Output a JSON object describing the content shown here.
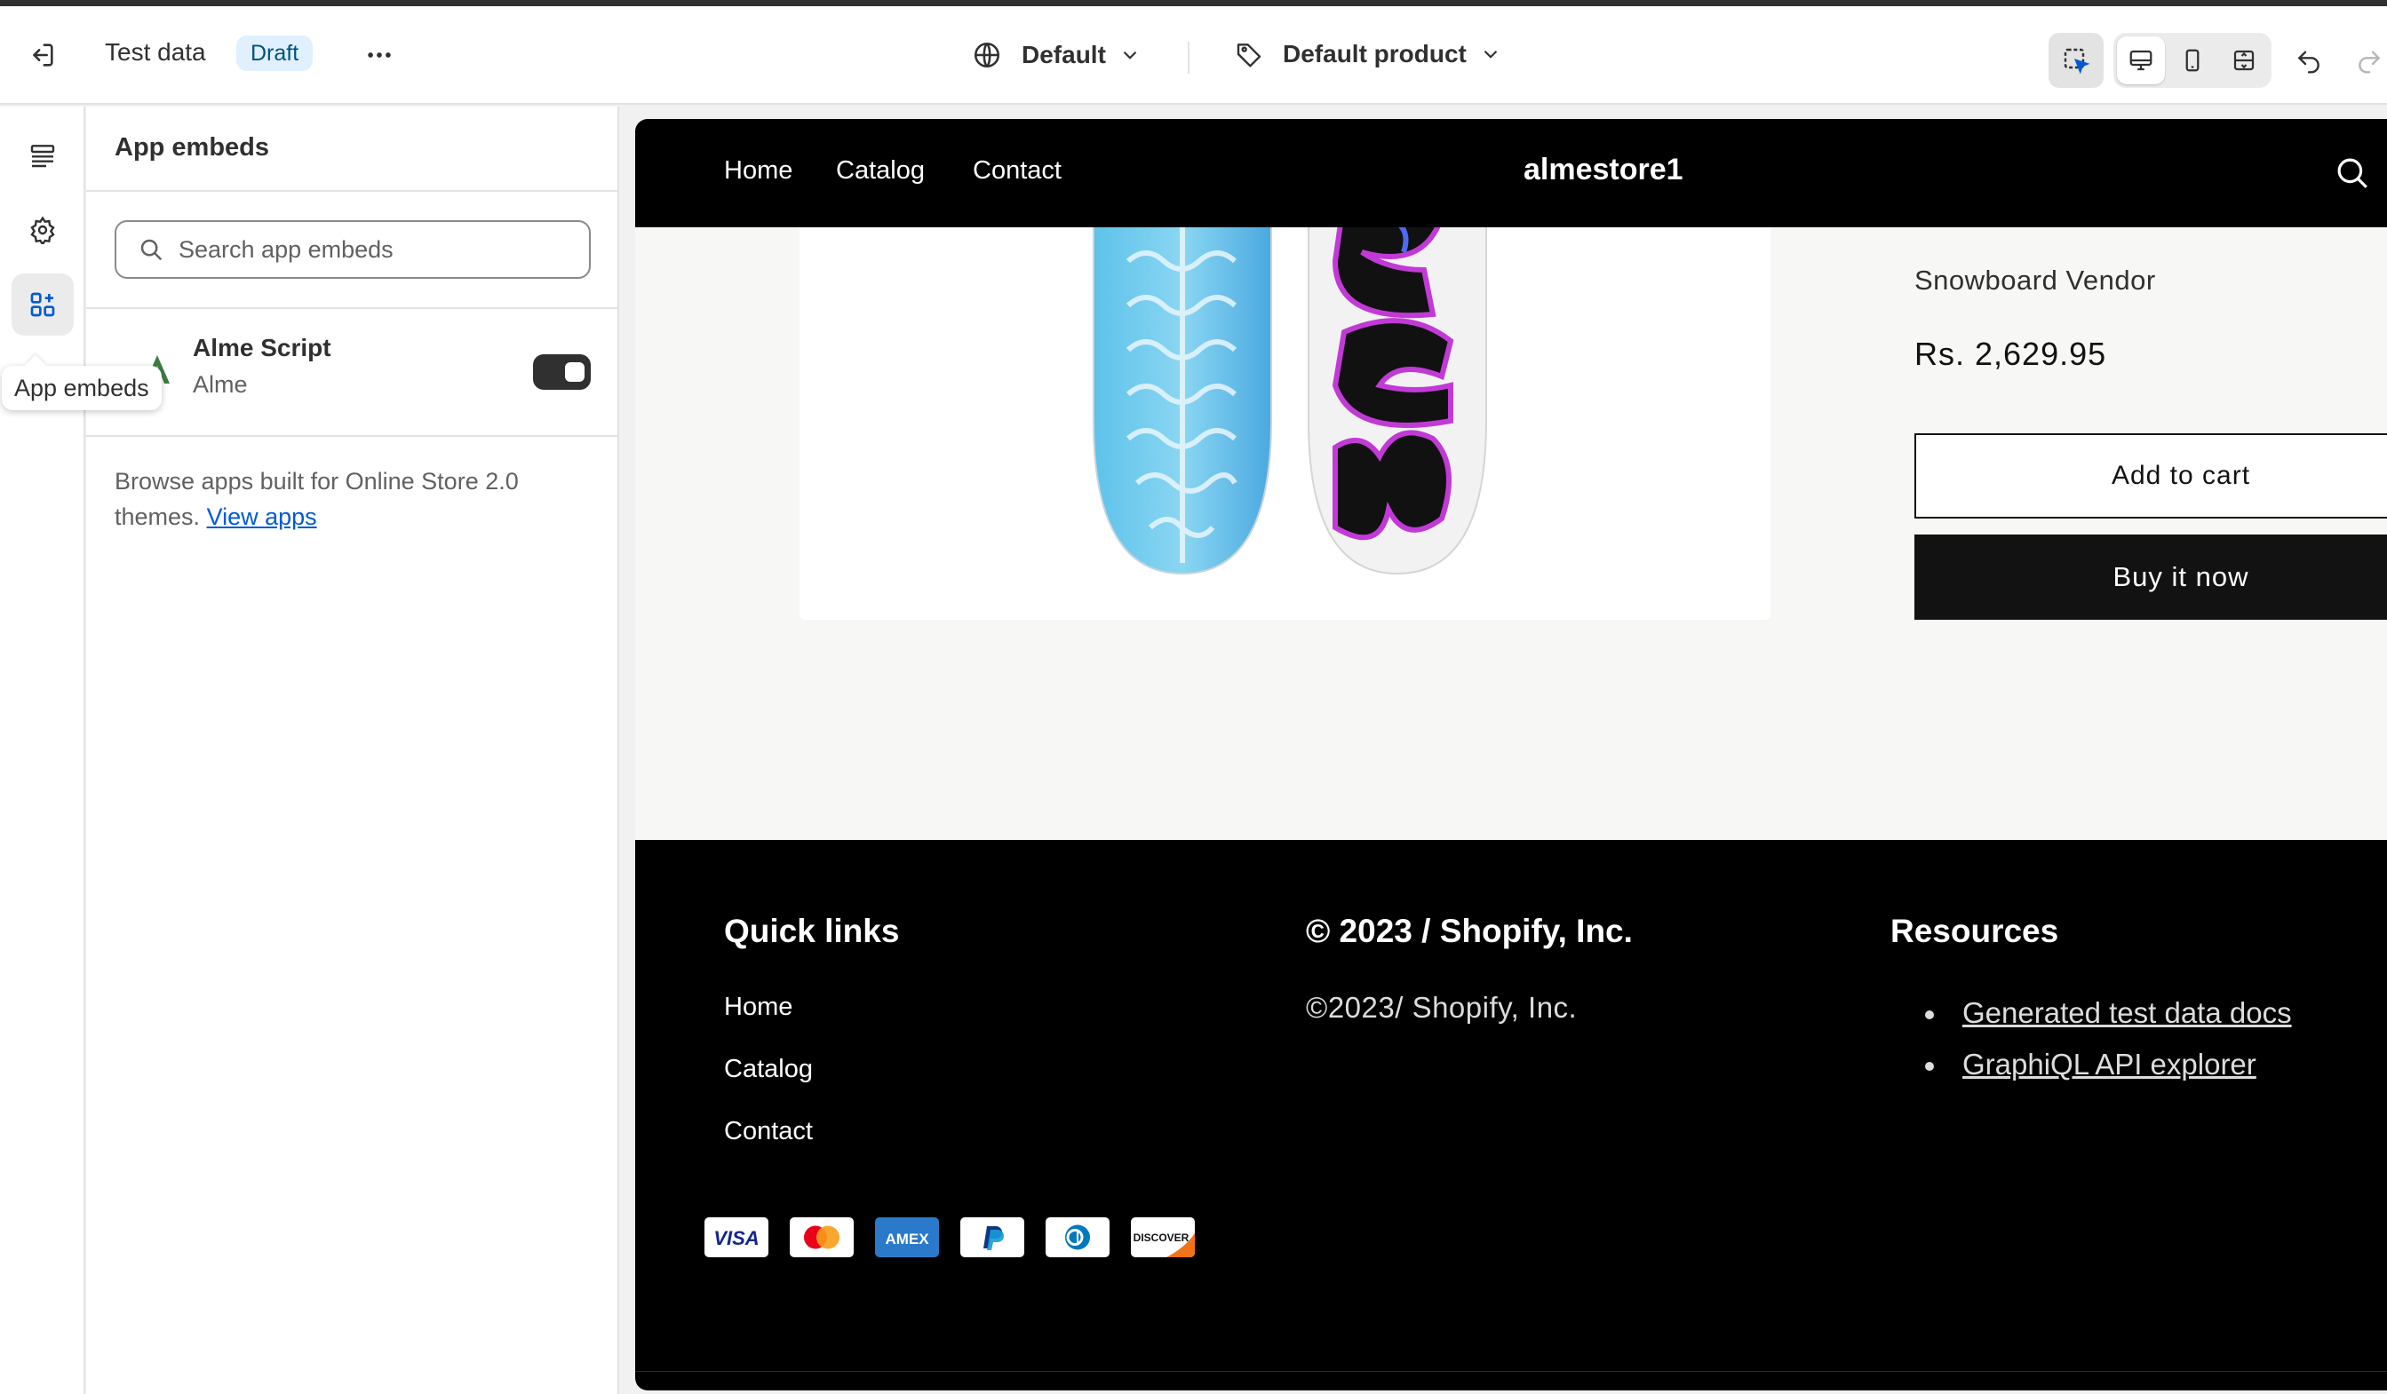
{
  "topbar": {
    "title": "Test data",
    "status_badge": "Draft",
    "language_select": "Default",
    "template_select": "Default product"
  },
  "rail": {
    "tooltip": "App embeds"
  },
  "panel": {
    "title": "App embeds",
    "search_placeholder": "Search app embeds",
    "embeds": [
      {
        "name": "Alme Script",
        "vendor": "Alme",
        "enabled": true
      }
    ],
    "browse_text": "Browse apps built for Online Store 2.0 themes.",
    "browse_link": "View apps"
  },
  "store": {
    "nav": [
      "Home",
      "Catalog",
      "Contact"
    ],
    "name": "almestore1",
    "product": {
      "vendor": "Snowboard Vendor",
      "price": "Rs. 2,629.95",
      "add_to_cart": "Add to cart",
      "buy_now": "Buy it now"
    },
    "footer": {
      "quick_links_heading": "Quick links",
      "quick_links": [
        "Home",
        "Catalog",
        "Contact"
      ],
      "copyright_heading": "© 2023 / Shopify, Inc.",
      "copyright_text": "©2023/ Shopify, Inc.",
      "resources_heading": "Resources",
      "resources": [
        "Generated test data docs",
        "GraphiQL API explorer"
      ]
    },
    "payment_icons": [
      "visa-icon",
      "mastercard-icon",
      "amex-icon",
      "paypal-icon",
      "diners-icon",
      "discover-icon"
    ]
  },
  "colors": {
    "accent": "#005bd3",
    "badge_bg": "#e0f0ff",
    "store_black": "#000000"
  }
}
